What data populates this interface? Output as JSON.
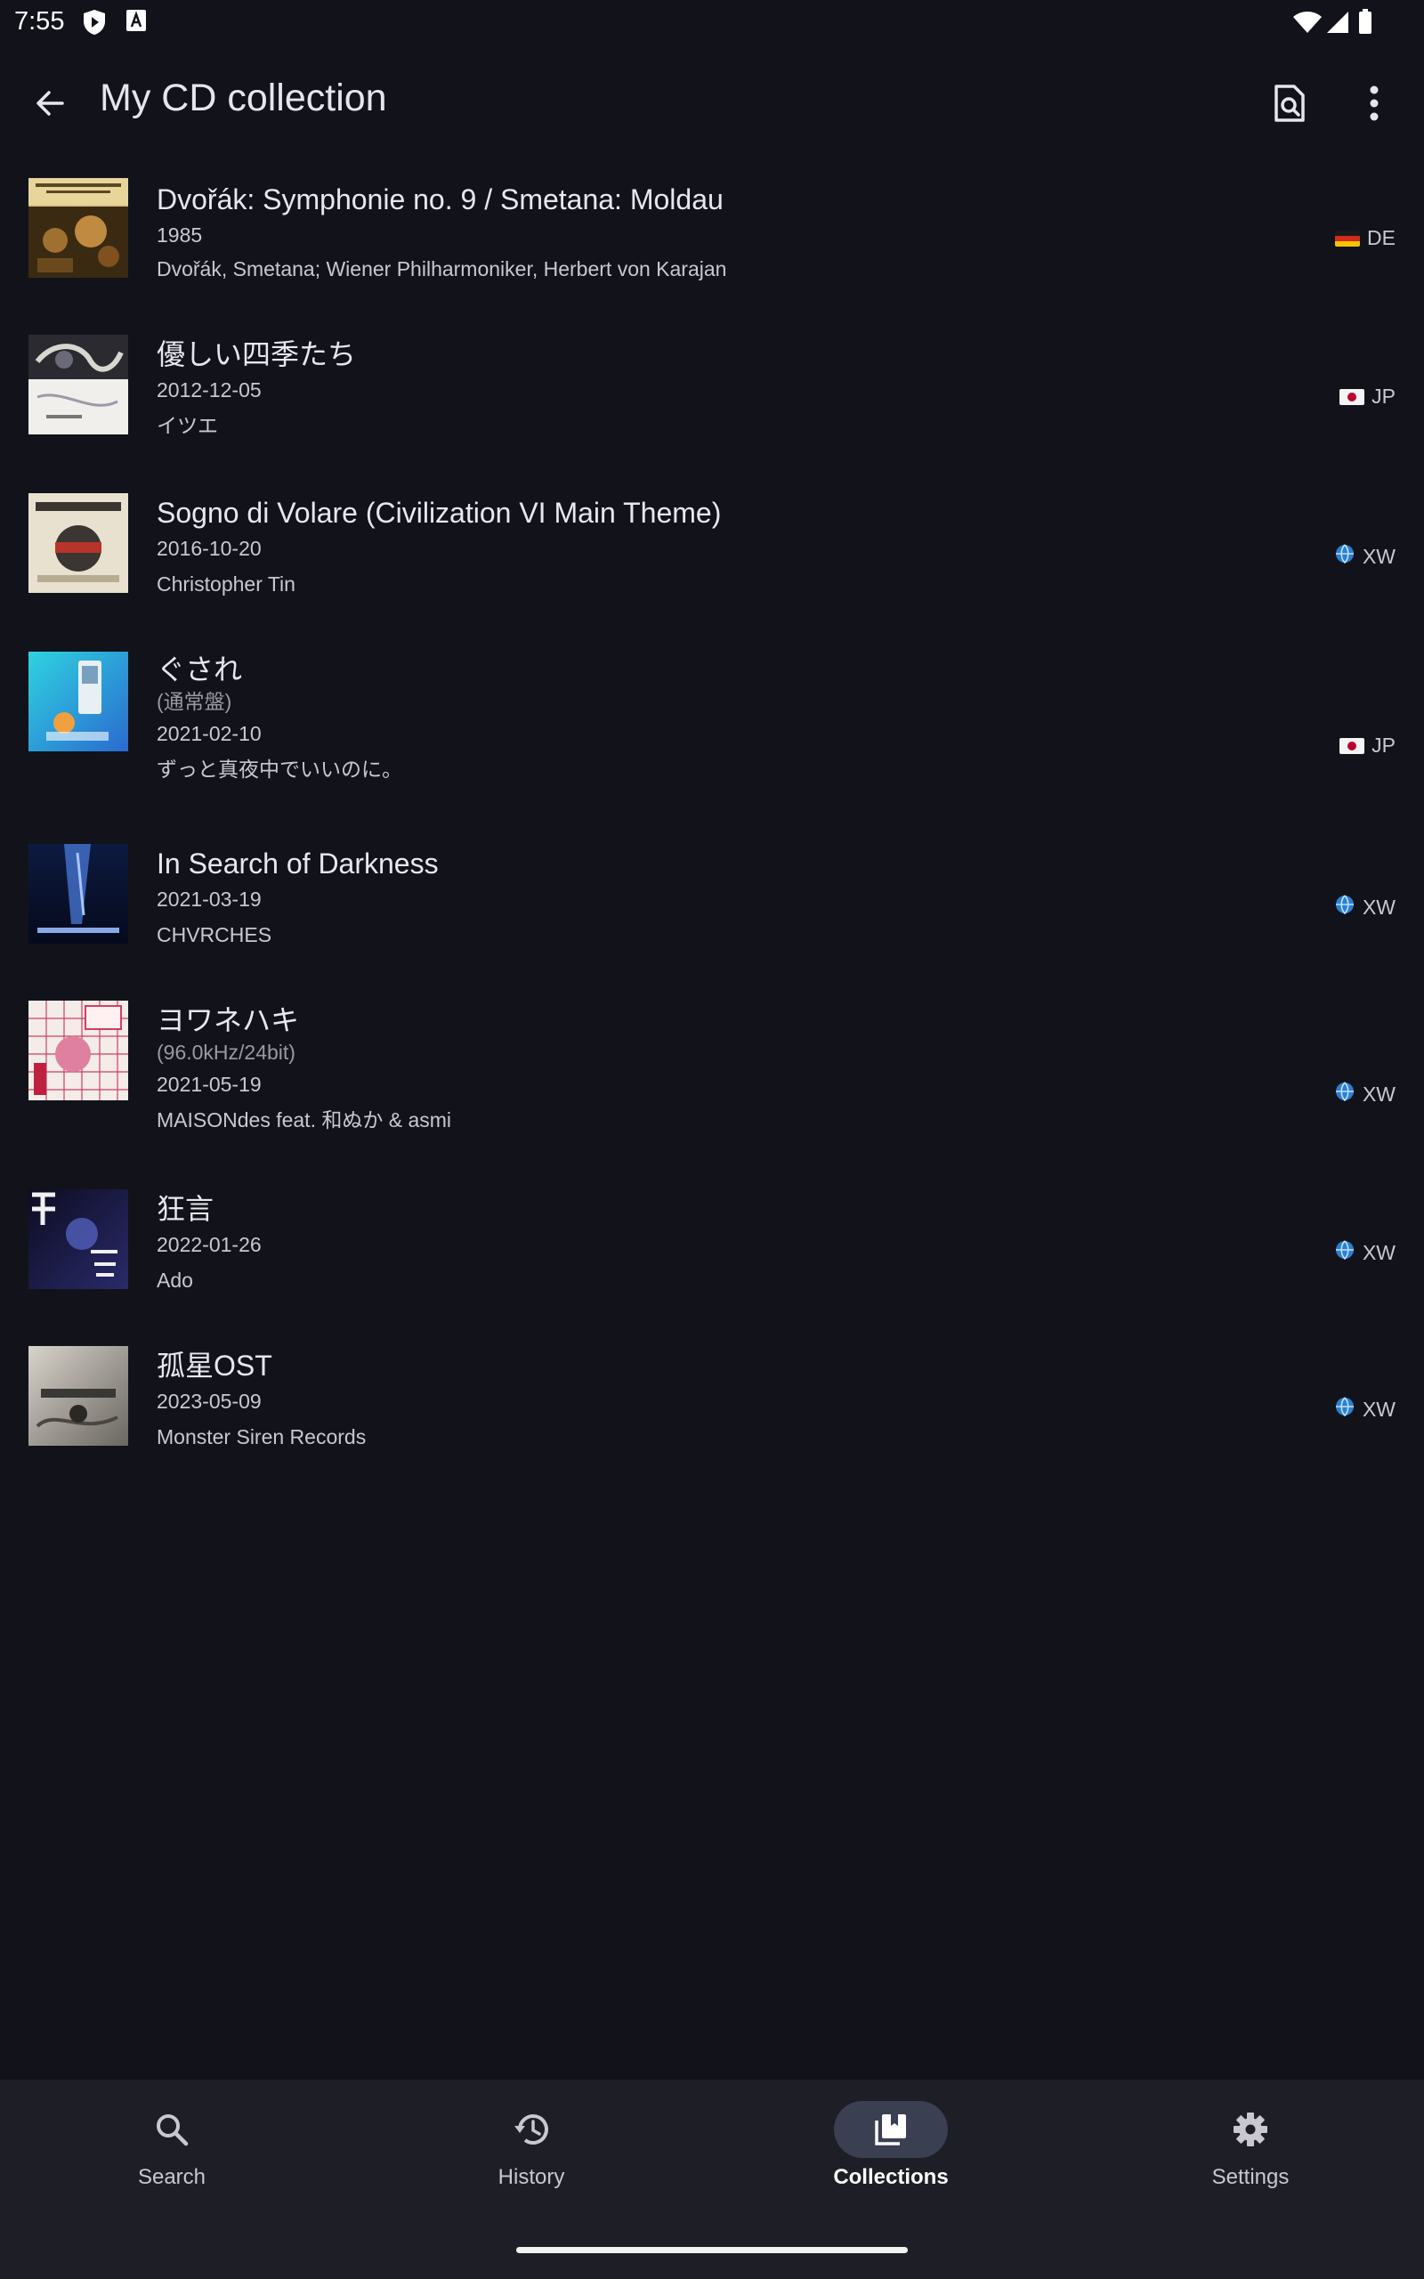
{
  "status_bar": {
    "time": "7:55"
  },
  "app_bar": {
    "title": "My CD collection"
  },
  "releases": [
    {
      "title": "Dvořák: Symphonie no. 9 / Smetana: Moldau",
      "disambiguation": "",
      "date": "1985",
      "artist": "Dvořák, Smetana; Wiener Philharmoniker, Herbert von Karajan",
      "country": "DE",
      "flag": "flag-germany"
    },
    {
      "title": "優しい四季たち",
      "disambiguation": "",
      "date": "2012-12-05",
      "artist": "イツエ",
      "country": "JP",
      "flag": "flag-japan"
    },
    {
      "title": "Sogno di Volare (Civilization VI Main Theme)",
      "disambiguation": "",
      "date": "2016-10-20",
      "artist": "Christopher Tin",
      "country": "XW",
      "flag": "globe-icon"
    },
    {
      "title": "ぐされ",
      "disambiguation": "(通常盤)",
      "date": "2021-02-10",
      "artist": "ずっと真夜中でいいのに。",
      "country": "JP",
      "flag": "flag-japan"
    },
    {
      "title": "In Search of Darkness",
      "disambiguation": "",
      "date": "2021-03-19",
      "artist": "CHVRCHES",
      "country": "XW",
      "flag": "globe-icon"
    },
    {
      "title": "ヨワネハキ",
      "disambiguation": "(96.0kHz/24bit)",
      "date": "2021-05-19",
      "artist": "MAISONdes feat. 和ぬか & asmi",
      "country": "XW",
      "flag": "globe-icon"
    },
    {
      "title": "狂言",
      "disambiguation": "",
      "date": "2022-01-26",
      "artist": "Ado",
      "country": "XW",
      "flag": "globe-icon"
    },
    {
      "title": "孤星OST",
      "disambiguation": "",
      "date": "2023-05-09",
      "artist": "Monster Siren Records",
      "country": "XW",
      "flag": "globe-icon"
    }
  ],
  "bottom_nav": [
    {
      "label": "Search",
      "icon": "search-icon",
      "active": false
    },
    {
      "label": "History",
      "icon": "history-icon",
      "active": false
    },
    {
      "label": "Collections",
      "icon": "collections-icon",
      "active": true
    },
    {
      "label": "Settings",
      "icon": "settings-icon",
      "active": false
    }
  ],
  "colors": {
    "background": "#12131a",
    "nav_background": "#1d1e26",
    "active_pill": "#3a3f52"
  }
}
